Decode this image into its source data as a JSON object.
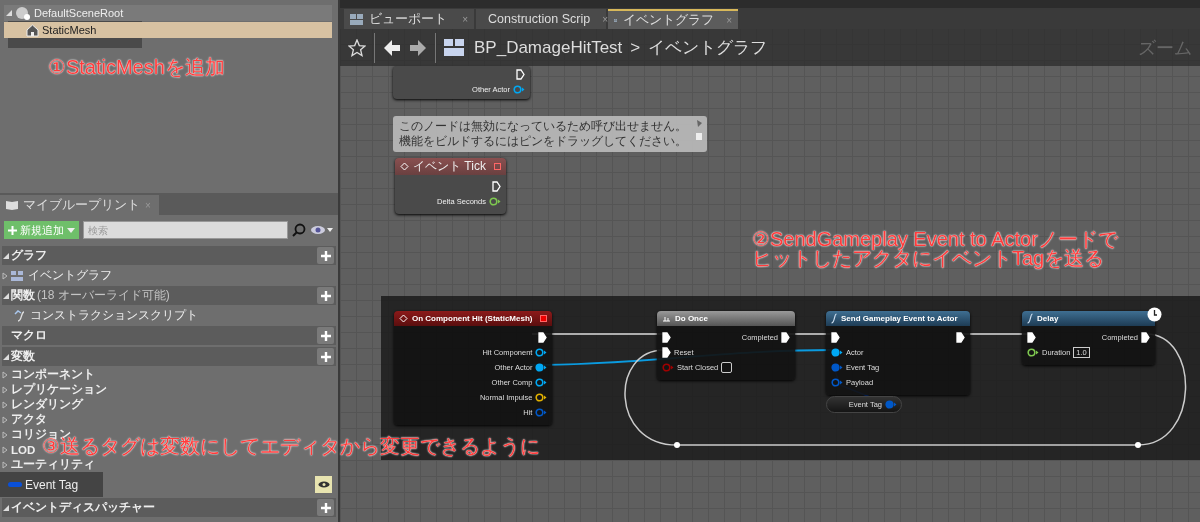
{
  "components_tree": [
    {
      "label": "DefaultSceneRoot",
      "expanded": true,
      "selected": false,
      "children": [
        {
          "label": "StaticMesh",
          "selected": true
        }
      ]
    }
  ],
  "my_blueprint": {
    "tab": {
      "label": "マイブループリント",
      "close": "×"
    },
    "add_button": "新規追加",
    "search": {
      "placeholder": "検索"
    },
    "sections": [
      {
        "title": "グラフ",
        "expanded": true,
        "items": [
          {
            "label": "イベントグラフ",
            "kind": "graph",
            "expanded": false
          }
        ]
      },
      {
        "title": "関数",
        "note": "(18 オーバーライド可能)",
        "expanded": true,
        "items": [
          {
            "label": "コンストラクションスクリプト",
            "kind": "function"
          }
        ]
      },
      {
        "title": "マクロ"
      },
      {
        "title": "変数",
        "expanded": true,
        "items": [
          {
            "label": "コンポーネント",
            "kind": "category",
            "expanded": false
          },
          {
            "label": "レプリケーション",
            "kind": "category",
            "expanded": false
          },
          {
            "label": "レンダリング",
            "kind": "category",
            "expanded": false
          },
          {
            "label": "アクタ",
            "kind": "category",
            "expanded": false
          },
          {
            "label": "コリジョン",
            "kind": "category",
            "expanded": false
          },
          {
            "label": "LOD",
            "kind": "category",
            "expanded": false
          },
          {
            "label": "ユーティリティ",
            "kind": "category",
            "expanded": false
          },
          {
            "label": "Event Tag",
            "kind": "variable",
            "color": "#0a50d8",
            "public": true
          }
        ]
      },
      {
        "title": "イベントディスパッチャー",
        "expanded": true
      }
    ]
  },
  "editor_tabs": [
    {
      "label": "ビューポート",
      "close": "×",
      "selected": false
    },
    {
      "label": "Construction Scrip",
      "close": "×",
      "selected": false
    },
    {
      "label": "イベントグラフ",
      "close": "×",
      "selected": true
    }
  ],
  "breadcrumb": {
    "blueprint": "BP_DamageHitTest",
    "separator": ">",
    "graph": "イベントグラフ",
    "zoom": "ズーム"
  },
  "nodes": [
    {
      "kind": "event",
      "disabled": true,
      "exec_out": true,
      "outputs": [
        {
          "label": "Other Actor",
          "color": "#00a8f4",
          "connected": false
        }
      ]
    },
    {
      "kind": "comment",
      "lines": [
        "このノードは無効になっているため呼び出せません。",
        "機能をビルドするにはピンをドラッグしてください。"
      ]
    },
    {
      "kind": "event",
      "disabled": true,
      "title": "イベント Tick",
      "exec_out": true,
      "outputs": [
        {
          "label": "Delta Seconds",
          "color": "#7ec850",
          "connected": false
        }
      ]
    },
    {
      "kind": "event",
      "disabled": false,
      "title": "On Component Hit (StaticMesh)",
      "exec_out": true,
      "outputs": [
        {
          "label": "Hit Component",
          "color": "#00a8f4",
          "connected": false
        },
        {
          "label": "Other Actor",
          "color": "#00a8f4",
          "connected": true
        },
        {
          "label": "Other Comp",
          "color": "#00a8f4",
          "connected": false
        },
        {
          "label": "Normal Impulse",
          "color": "#e0b000",
          "connected": false
        },
        {
          "label": "Hit",
          "color": "#0058c8",
          "connected": false
        }
      ]
    },
    {
      "kind": "macro",
      "disabled": false,
      "title": "Do Once",
      "exec_in": true,
      "exec_out_label": "Completed",
      "inputs": [
        {
          "label": "Reset",
          "kind": "exec",
          "connected": true
        },
        {
          "label": "Start Closed",
          "kind": "data",
          "color": "#a00000",
          "connected": false,
          "checked": false
        }
      ]
    },
    {
      "kind": "function",
      "disabled": false,
      "title": "Send Gameplay Event to Actor",
      "exec_in": true,
      "exec_out": true,
      "inputs": [
        {
          "label": "Actor",
          "kind": "data",
          "color": "#00a8f4",
          "connected": true
        },
        {
          "label": "Event Tag",
          "kind": "data",
          "color": "#0058c8",
          "connected": true
        },
        {
          "label": "Payload",
          "kind": "data",
          "color": "#0058c8",
          "connected": false
        }
      ]
    },
    {
      "kind": "getter",
      "title": "Event Tag",
      "color": "#0058c8"
    },
    {
      "kind": "function",
      "disabled": false,
      "title": "Delay",
      "latent": true,
      "exec_in": true,
      "exec_out_label": "Completed",
      "inputs": [
        {
          "label": "Duration",
          "kind": "data",
          "color": "#7ec850",
          "connected": false,
          "value": "1.0"
        }
      ]
    }
  ],
  "annotations": [
    {
      "lines": [
        "①StaticMeshを追加"
      ]
    },
    {
      "lines": [
        "②SendGameplay Event to Actorノードで",
        "ヒットしたアクタにイベントTagを送る"
      ]
    },
    {
      "lines": [
        "③送るタグは変数にしてエディタから変更できるように"
      ]
    }
  ]
}
